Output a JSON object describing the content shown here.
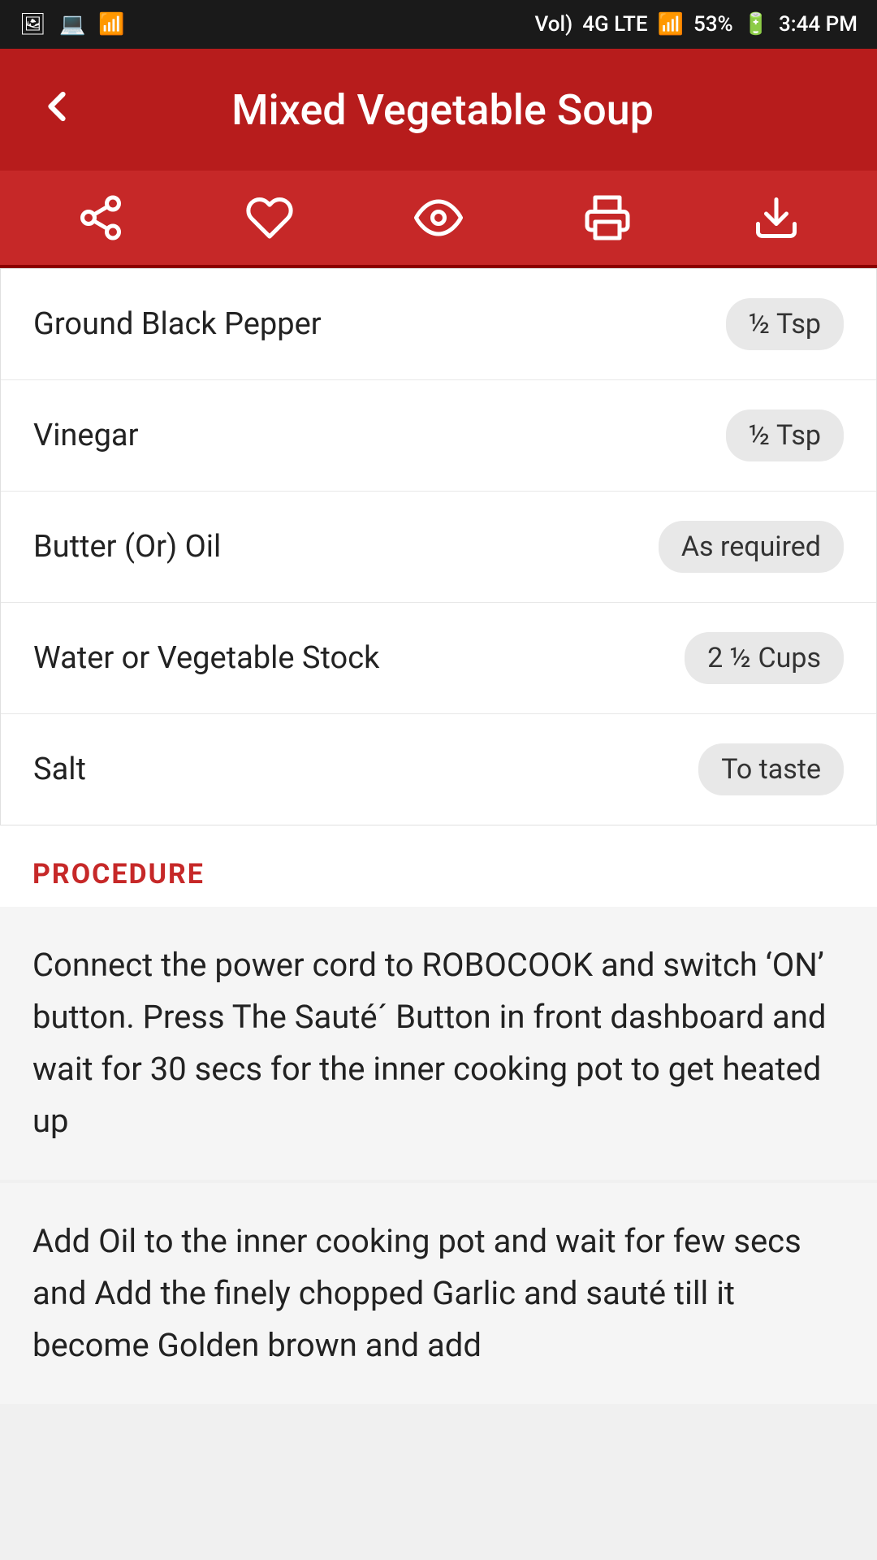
{
  "statusBar": {
    "time": "3:44 PM",
    "battery": "53%",
    "signal": "4G",
    "icons": [
      "image-icon",
      "laptop-icon",
      "wifi-icon"
    ]
  },
  "header": {
    "title": "Mixed Vegetable Soup",
    "backLabel": "‹"
  },
  "toolbar": {
    "items": [
      {
        "name": "share-icon",
        "symbol": "share"
      },
      {
        "name": "favorite-icon",
        "symbol": "heart"
      },
      {
        "name": "view-icon",
        "symbol": "eye"
      },
      {
        "name": "print-icon",
        "symbol": "print"
      },
      {
        "name": "download-icon",
        "symbol": "download"
      }
    ]
  },
  "ingredients": [
    {
      "name": "Ground Black Pepper",
      "amount": "½ Tsp"
    },
    {
      "name": "Vinegar",
      "amount": "½ Tsp"
    },
    {
      "name": "Butter (Or) Oil",
      "amount": "As required"
    },
    {
      "name": "Water or Vegetable Stock",
      "amount": "2 ½ Cups"
    },
    {
      "name": "Salt",
      "amount": "To taste"
    }
  ],
  "procedure": {
    "label": "PROCEDURE",
    "steps": [
      "Connect the power cord to ROBOCOOK and switch ‘ON’ button. Press The Sauté´ Button in front dashboard and wait for 30 secs for the inner cooking pot to get heated up",
      "Add Oil to the inner cooking pot and wait for few secs and Add the finely chopped Garlic and sauté till it become Golden brown and add"
    ]
  }
}
